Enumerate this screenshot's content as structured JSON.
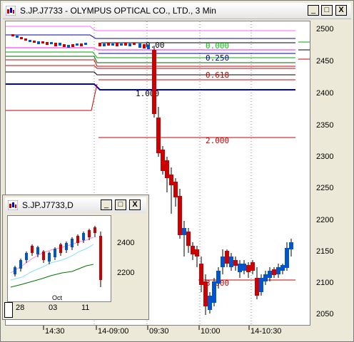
{
  "window": {
    "title": "S.JP.J7733 - OLYMPUS OPTICAL CO., LTD., 3 Min"
  },
  "controls": {
    "minimize": "_",
    "maximize": "□",
    "close": "X"
  },
  "chart": {
    "price_axis": [
      "2500",
      "2450",
      "2400",
      "2350",
      "2300",
      "2250",
      "2200",
      "2150",
      "2100",
      "2050"
    ],
    "time_axis": [
      "14:30",
      "14-09:00",
      "09:30",
      "10:00",
      "14-10:30"
    ],
    "fib_levels": [
      {
        "label": "0.000",
        "color": "#00cc00"
      },
      {
        "label": "0.250",
        "color": "#000099"
      },
      {
        "label": "0.618",
        "color": "#cc0000"
      },
      {
        "label": "1.000",
        "color": "#000000"
      },
      {
        "label": "2.000",
        "color": "#cc0000"
      },
      {
        "label": "3.000",
        "color": "#cc0000"
      }
    ],
    "fib_hidden": "0.00"
  },
  "inner_window": {
    "title": "S.JP.J7733,D",
    "price_axis": [
      "2400",
      "2200"
    ],
    "month_label": "Oct",
    "date_axis": [
      "28",
      "03",
      "11"
    ]
  },
  "chart_data": {
    "type": "candlestick",
    "y_axis_ticks": [
      2500,
      2450,
      2400,
      2350,
      2300,
      2250,
      2200,
      2150,
      2100,
      2050
    ],
    "x_axis_ticks": [
      "14:30",
      "14-09:00",
      "09:30",
      "10:00",
      "14-10:30"
    ],
    "fib_labels": [
      "0.000",
      "0.250",
      "0.618",
      "1.000",
      "2.000",
      "3.000"
    ]
  }
}
